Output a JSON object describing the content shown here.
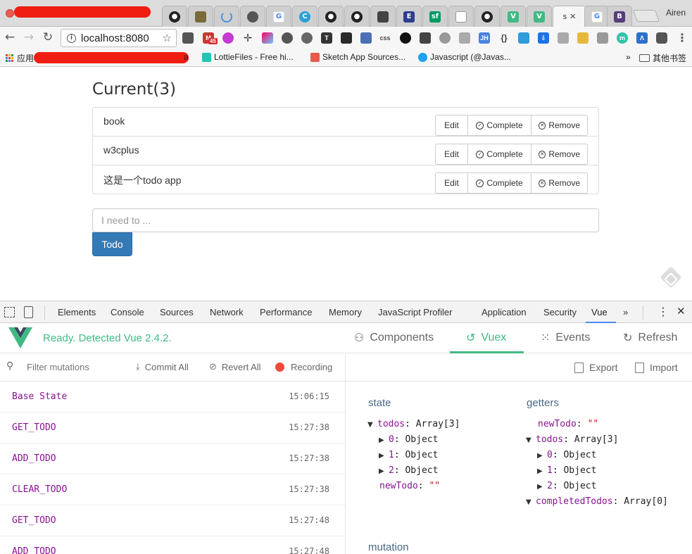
{
  "browser": {
    "profile_name": "Airen",
    "active_tab_label": "s",
    "url": "localhost:8080",
    "ext_badge": "45",
    "bookmarks": {
      "apps_label": "应用",
      "hidden_text": "a",
      "item1": "LottieFiles - Free hi...",
      "item2": "Sketch App Sources...",
      "item3": "Javascript (@Javas...",
      "overflow": "»",
      "other": "其他书签"
    }
  },
  "page": {
    "heading": "Current(3)",
    "todos": [
      {
        "text": "book"
      },
      {
        "text": "w3cplus"
      },
      {
        "text": "这是一个todo app"
      }
    ],
    "actions": {
      "edit": "Edit",
      "complete": "Complete",
      "remove": "Remove"
    },
    "input_placeholder": "I need to ...",
    "submit_label": "Todo"
  },
  "devtools": {
    "tabs": [
      "Elements",
      "Console",
      "Sources",
      "Network",
      "Performance",
      "Memory",
      "JavaScript Profiler",
      "Application",
      "Security",
      "Vue"
    ],
    "more": "»",
    "vue": {
      "status": "Ready. Detected Vue 2.4.2.",
      "tabs": {
        "components": "Components",
        "vuex": "Vuex",
        "events": "Events",
        "refresh": "Refresh"
      },
      "filter_placeholder": "Filter mutations",
      "commit_all": "Commit All",
      "revert_all": "Revert All",
      "recording": "Recording",
      "export": "Export",
      "import": "Import",
      "mutations": [
        {
          "name": "Base State",
          "time": "15:06:15"
        },
        {
          "name": "GET_TODO",
          "time": "15:27:38"
        },
        {
          "name": "ADD_TODO",
          "time": "15:27:38"
        },
        {
          "name": "CLEAR_TODO",
          "time": "15:27:38"
        },
        {
          "name": "GET_TODO",
          "time": "15:27:48"
        },
        {
          "name": "ADD_TODO",
          "time": "15:27:48"
        }
      ],
      "state": {
        "title": "state",
        "todos_key": "todos",
        "todos_val": "Array[3]",
        "items": [
          "0",
          "1",
          "2"
        ],
        "item_val": "Object",
        "newTodo_key": "newTodo",
        "newTodo_val": "\"\""
      },
      "getters": {
        "title": "getters",
        "newTodo_key": "newTodo",
        "newTodo_val": "\"\"",
        "todos_key": "todos",
        "todos_val": "Array[3]",
        "items": [
          "0",
          "1",
          "2"
        ],
        "item_val": "Object",
        "completed_key": "completedTodos",
        "completed_val": "Array[0]"
      },
      "mutation_title": "mutation"
    }
  }
}
